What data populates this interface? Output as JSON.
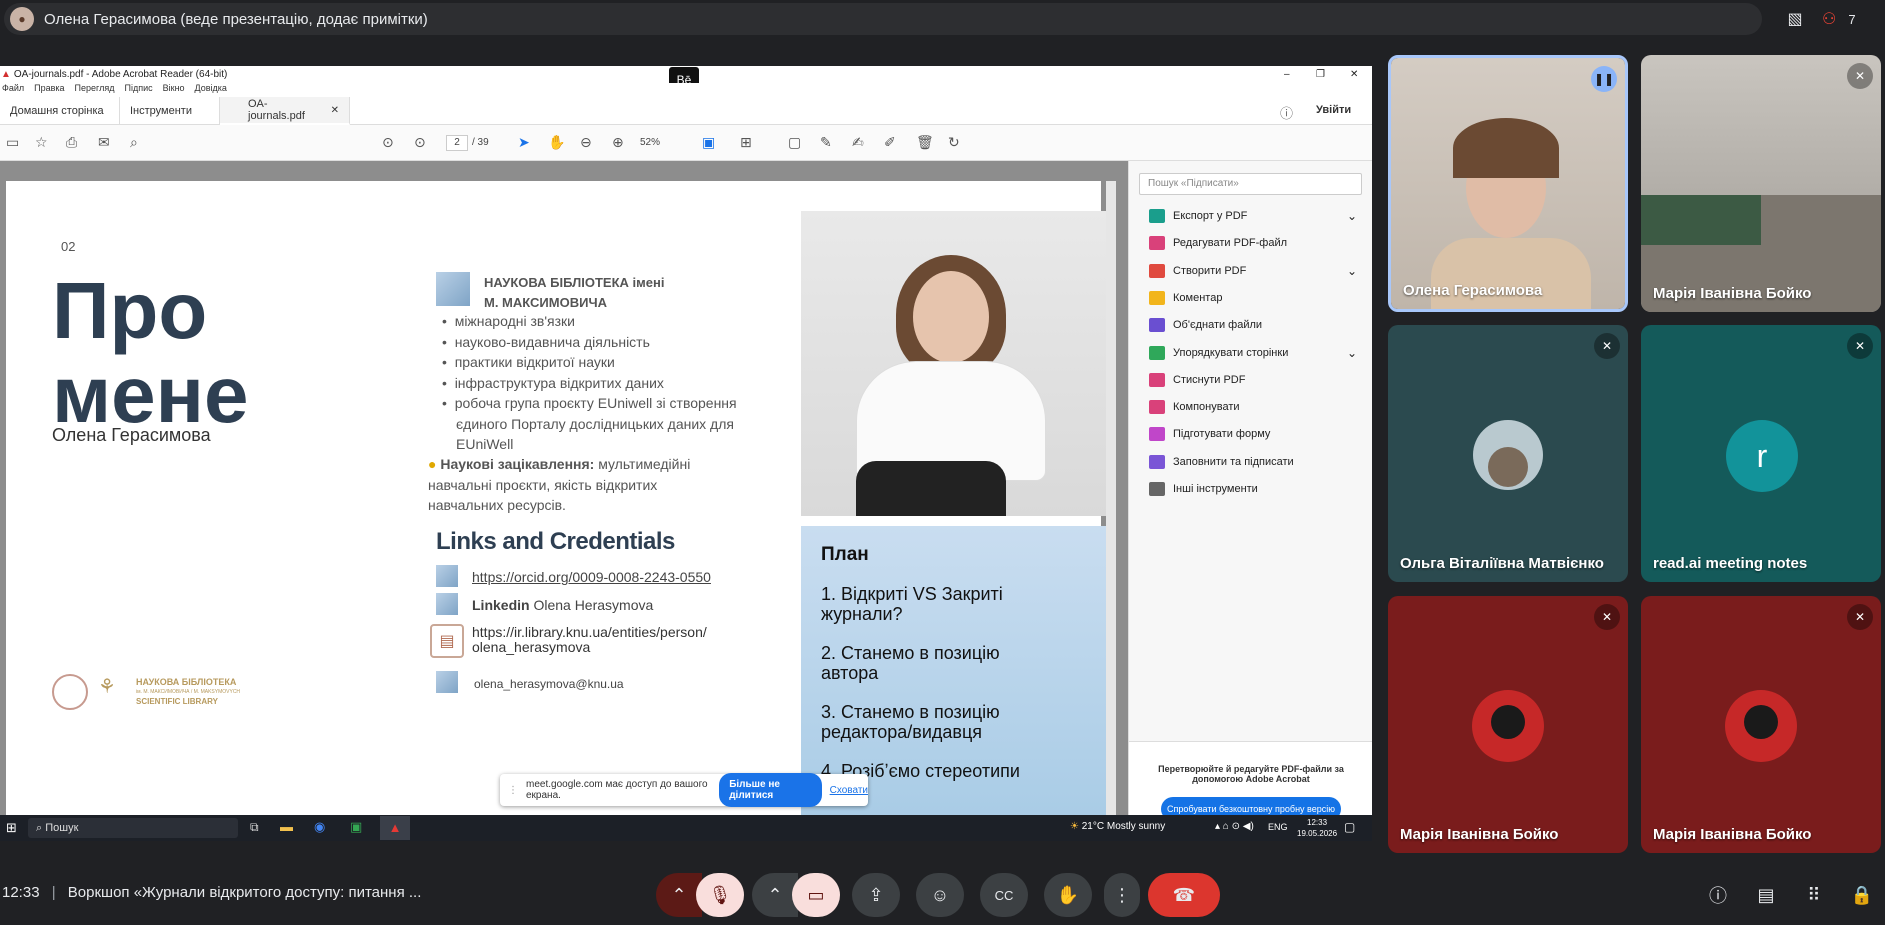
{
  "topbar": {
    "presenter_text": "Олена Герасимова (веде презентацію, додає примітки)",
    "participants_count": "7"
  },
  "acrobat": {
    "window_title": "OA-journals.pdf - Adobe Acrobat Reader (64-bit)",
    "menu": [
      "Файл",
      "Правка",
      "Перегляд",
      "Підпис",
      "Вікно",
      "Довідка"
    ],
    "tabs": [
      "Домашня сторінка",
      "Інструменти",
      "OA-journals.pdf"
    ],
    "signin": "Увійти",
    "page_current": "2",
    "page_total": "/ 39",
    "zoom": "52%",
    "search_placeholder": "Пошук «Підписати»",
    "tools": [
      {
        "label": "Експорт у PDF",
        "color": "#1a9e8c",
        "chevron": true
      },
      {
        "label": "Редагувати PDF-файл",
        "color": "#d9417a",
        "chevron": false
      },
      {
        "label": "Створити PDF",
        "color": "#e04a3f",
        "chevron": true
      },
      {
        "label": "Коментар",
        "color": "#f2b51c",
        "chevron": false
      },
      {
        "label": "Об'єднати файли",
        "color": "#6a4fd1",
        "chevron": false
      },
      {
        "label": "Упорядкувати сторінки",
        "color": "#2fa85a",
        "chevron": true
      },
      {
        "label": "Стиснути PDF",
        "color": "#d9417a",
        "chevron": false
      },
      {
        "label": "Компонувати",
        "color": "#d9417a",
        "chevron": false
      },
      {
        "label": "Підготувати форму",
        "color": "#c046c9",
        "chevron": false
      },
      {
        "label": "Заповнити та підписати",
        "color": "#7a55d6",
        "chevron": false
      },
      {
        "label": "Інші інструменти",
        "color": "#666666",
        "chevron": false
      }
    ],
    "promo_text": "Перетворюйте й редагуйте PDF-файли за допомогою Adobe Acrobat",
    "promo_button": "Спробувати безкоштовну пробну версію"
  },
  "slide": {
    "number": "02",
    "title_line1": "Про",
    "title_line2": "мене",
    "author": "Олена Герасимова",
    "library_line1": "НАУКОВА БІБЛІОТЕКА імені",
    "library_line2": "М. МАКСИМОВИЧА",
    "bullets": [
      "міжнародні зв'язки",
      "науково-видавнича діяльність",
      "практики відкритої науки",
      "інфраструктура відкритих даних",
      "робоча група проєкту EUniwell зі створення",
      "єдиного Порталу дослідницьких даних для",
      "EUniWell"
    ],
    "interests_label": "Наукові зацікавлення:",
    "interests_text": " мультимедійні",
    "interests_line2": "навчальні проєкти, якість відкритих",
    "interests_line3": "навчальних ресурсів.",
    "links_heading": "Links and Credentials",
    "orcid": "https://orcid.org/0009-0008-2243-0550",
    "linkedin_label": "Linkedin",
    "linkedin_name": " Olena Herasymova",
    "repo_line1": "https://ir.library.knu.ua/entities/person/",
    "repo_line2": "olena_herasymova",
    "email": "olena_herasymova@knu.ua",
    "logo_line1": "НАУКОВА БІБЛІОТЕКА",
    "logo_line2": "ім. М. МАКСИМОВИЧА / M. MAKSYMOVYCH",
    "logo_line3": "SCIENTIFIC LIBRARY",
    "plan_title": "План",
    "plan_items": [
      "1. Відкриті VS Закриті",
      "журнали?",
      "2. Станемо в позицію",
      "автора",
      "3. Станемо в позицію",
      "редактора/видавця",
      "4. Розібʼємо стереотипи"
    ]
  },
  "share_popup": {
    "text": "meet.google.com має доступ до вашого екрана.",
    "stop_button": "Більше не ділитися",
    "hide_link": "Сховати"
  },
  "taskbar": {
    "search": "Пошук",
    "weather": "21°C  Mostly sunny",
    "lang": "ENG",
    "time": "12:33",
    "date": "19.05.2026"
  },
  "participants": [
    {
      "name": "Олена Герасимова",
      "bg": "#cfc8c0"
    },
    {
      "name": "Марія Іванівна Бойко",
      "bg": "#b9b4ad"
    },
    {
      "name": "Ольга Віталіївна Матвієнко",
      "bg": "#2b4a4f"
    },
    {
      "name": "read.ai meeting notes",
      "bg": "#145a5a",
      "initial": "r"
    },
    {
      "name": "Марія Іванівна Бойко",
      "bg": "#7a1c1c"
    },
    {
      "name": "Марія Іванівна Бойко",
      "bg": "#7a1c1c"
    }
  ],
  "bottombar": {
    "time": "12:33",
    "meeting_title": "Воркшоп «Журнали відкритого доступу: питання ..."
  }
}
